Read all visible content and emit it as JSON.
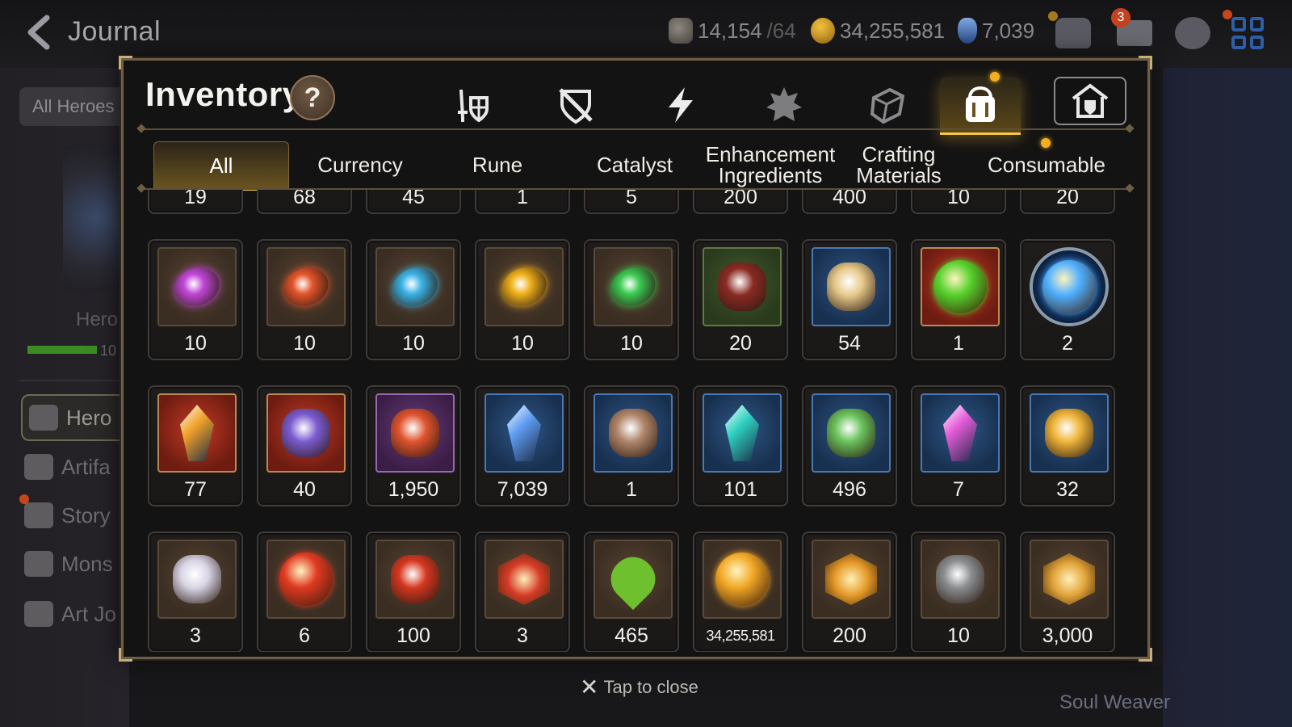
{
  "topbar": {
    "title": "Journal",
    "stamina_value": "14,154",
    "stamina_max": "/64",
    "gold_value": "34,255,581",
    "skystone_value": "7,039",
    "mail_badge": "3"
  },
  "background": {
    "filter_chip": "All Heroes",
    "hero_label": "Hero",
    "progress_num": "10",
    "side_menu": [
      "Hero",
      "Artifa",
      "Story",
      "Mons",
      "Art Jo"
    ],
    "soul_label": "Soul Weaver"
  },
  "inventory": {
    "title": "Inventory",
    "help_label": "?",
    "category_tabs": [
      {
        "name": "equipment",
        "icon": "sword-shield-icon"
      },
      {
        "name": "no-equip",
        "icon": "crossed-shield-icon"
      },
      {
        "name": "artifact",
        "icon": "lightning-icon"
      },
      {
        "name": "hero",
        "icon": "emblem-icon"
      },
      {
        "name": "material",
        "icon": "cube-icon"
      },
      {
        "name": "items",
        "icon": "bag-icon"
      },
      {
        "name": "storage",
        "icon": "house-shield-icon"
      }
    ],
    "subtabs": [
      "All",
      "Currency",
      "Rune",
      "Catalyst",
      "Enhancement Ingredients",
      "Crafting Materials",
      "Consumable"
    ],
    "items": [
      {
        "qty": "19",
        "kind": "plain"
      },
      {
        "qty": "68",
        "kind": "plain"
      },
      {
        "qty": "45",
        "kind": "plain"
      },
      {
        "qty": "1",
        "kind": "plain"
      },
      {
        "qty": "5",
        "kind": "plain"
      },
      {
        "qty": "200",
        "kind": "plain"
      },
      {
        "qty": "400",
        "kind": "plain"
      },
      {
        "qty": "10",
        "kind": "plain"
      },
      {
        "qty": "20",
        "kind": "plain"
      },
      {
        "qty": "10",
        "kind": "plain",
        "icon": "purple-rune-icon",
        "color": "#c247d8"
      },
      {
        "qty": "10",
        "kind": "plain",
        "icon": "red-rune-icon",
        "color": "#e4542a"
      },
      {
        "qty": "10",
        "kind": "plain",
        "icon": "blue-rune-icon",
        "color": "#3bb4e6"
      },
      {
        "qty": "10",
        "kind": "plain",
        "icon": "yellow-rune-icon",
        "color": "#f0b11a"
      },
      {
        "qty": "10",
        "kind": "plain",
        "icon": "green-rune-icon",
        "color": "#3ccb52"
      },
      {
        "qty": "20",
        "kind": "green",
        "icon": "claw-icon",
        "color": "#8a2a22"
      },
      {
        "qty": "54",
        "kind": "blue",
        "icon": "ginseng-root-icon",
        "color": "#e7c98a"
      },
      {
        "qty": "1",
        "kind": "red",
        "icon": "green-orb-icon",
        "color": "#56d12b"
      },
      {
        "qty": "2",
        "kind": "circle",
        "icon": "blue-sigil-icon",
        "color": "#4fb0ff"
      },
      {
        "qty": "77",
        "kind": "red",
        "icon": "amber-crystal-icon",
        "color": "#f0a22a"
      },
      {
        "qty": "40",
        "kind": "red",
        "icon": "pendant-icon",
        "color": "#7c5bd0"
      },
      {
        "qty": "1,950",
        "kind": "purple",
        "icon": "red-flower-ring-icon",
        "color": "#e0532e"
      },
      {
        "qty": "7,039",
        "kind": "blue",
        "icon": "skystone-icon",
        "color": "#5f9df2"
      },
      {
        "qty": "1",
        "kind": "blue",
        "icon": "compass-pendant-icon",
        "color": "#b0866a"
      },
      {
        "qty": "101",
        "kind": "blue",
        "icon": "teal-crystal-icon",
        "color": "#2fd1c1"
      },
      {
        "qty": "496",
        "kind": "blue",
        "icon": "leaf-icon",
        "color": "#69c25c"
      },
      {
        "qty": "7",
        "kind": "blue",
        "icon": "pink-crystal-cluster-icon",
        "color": "#e35ad8"
      },
      {
        "qty": "32",
        "kind": "blue",
        "icon": "star-compass-icon",
        "color": "#f0b53a"
      },
      {
        "qty": "3",
        "kind": "plain",
        "icon": "robot-pod-icon",
        "color": "#d9d5e6"
      },
      {
        "qty": "6",
        "kind": "plain",
        "icon": "fire-orb-icon",
        "color": "#e03a22"
      },
      {
        "qty": "100",
        "kind": "plain",
        "icon": "red-bracelet-icon",
        "color": "#d5371f"
      },
      {
        "qty": "3",
        "kind": "plain",
        "icon": "red-seal-icon",
        "color": "#d63b27"
      },
      {
        "qty": "465",
        "kind": "plain",
        "icon": "green-heart-icon",
        "color": "#6ec02f"
      },
      {
        "qty": "34,255,581",
        "kind": "plain",
        "icon": "gold-coin-icon",
        "color": "#f2a826"
      },
      {
        "qty": "200",
        "kind": "plain",
        "icon": "gold-hex-emblem-icon",
        "color": "#e69b2a"
      },
      {
        "qty": "10",
        "kind": "plain",
        "icon": "stone-compass-icon",
        "color": "#8a8e90"
      },
      {
        "qty": "3,000",
        "kind": "plain",
        "icon": "gold-fist-emblem-icon",
        "color": "#e2a43a"
      }
    ]
  },
  "footer": {
    "close_hint": "Tap to close"
  }
}
